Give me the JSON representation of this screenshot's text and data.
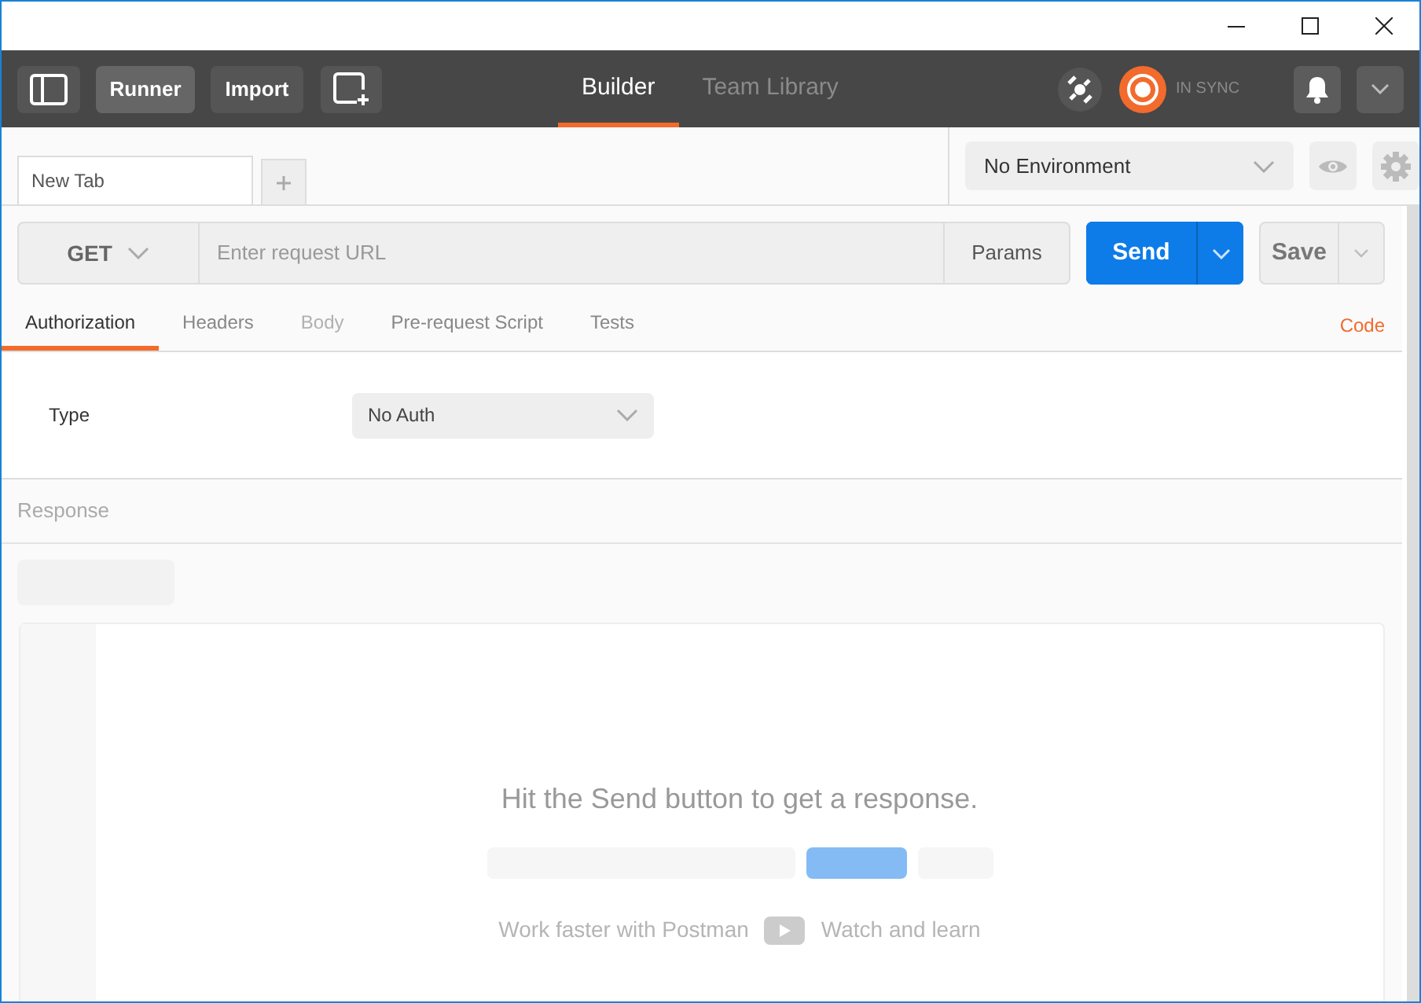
{
  "header": {
    "buttons": [
      "Runner",
      "Import"
    ],
    "tabs": [
      {
        "label": "Builder",
        "selected": true
      },
      {
        "label": "Team Library",
        "selected": false
      }
    ],
    "sync_status": "IN SYNC"
  },
  "request_tabs": [
    {
      "label": "New Tab",
      "selected": true
    }
  ],
  "environment": {
    "value": "No Environment"
  },
  "request": {
    "method": "GET",
    "url_placeholder": "Enter request URL",
    "params": "Params",
    "send": "Send",
    "save": "Save"
  },
  "sub_tabs": [
    {
      "label": "Authorization",
      "selected": true,
      "disabled": false
    },
    {
      "label": "Headers",
      "selected": false,
      "disabled": false
    },
    {
      "label": "Body",
      "selected": false,
      "disabled": true
    },
    {
      "label": "Pre-request Script",
      "selected": false,
      "disabled": false
    },
    {
      "label": "Tests",
      "selected": false,
      "disabled": false
    }
  ],
  "code_link": "Code",
  "auth": {
    "label": "Type",
    "value": "No Auth"
  },
  "response": {
    "title": "Response",
    "message": "Hit the Send button to get a response.",
    "tip": "Work faster with Postman",
    "watch": "Watch and learn"
  }
}
